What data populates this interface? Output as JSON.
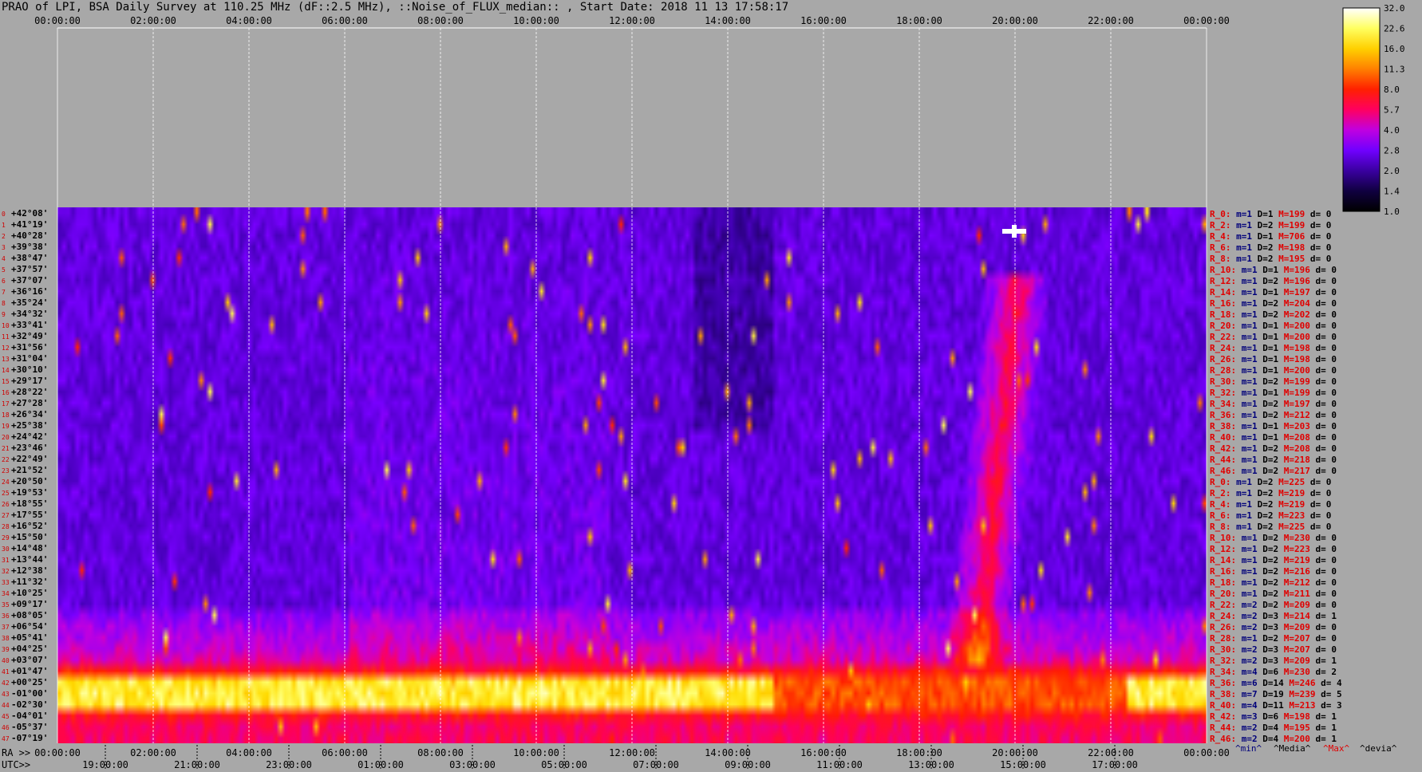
{
  "title": "PRAO of LPI, BSA Daily Survey at 110.25 MHz (dF::2.5 MHz), ::Noise_of_FLUX_median:: , Start Date: 2018 11 13 17:58:17",
  "axis_prefix": {
    "ra": "RA >>",
    "utc": "UTC>>"
  },
  "chart_data": {
    "type": "heatmap",
    "title": "PRAO of LPI, BSA Daily Survey at 110.25 MHz (dF::2.5 MHz), ::Noise_of_FLUX_median:: , Start Date: 2018 11 13 17:58:17",
    "x_ra_ticks": [
      "00:00:00",
      "02:00:00",
      "04:00:00",
      "06:00:00",
      "08:00:00",
      "10:00:00",
      "12:00:00",
      "14:00:00",
      "16:00:00",
      "18:00:00",
      "20:00:00",
      "22:00:00",
      "00:00:00"
    ],
    "x_utc_ticks": [
      "19:00:00",
      "21:00:00",
      "23:00:00",
      "01:00:00",
      "03:00:00",
      "05:00:00",
      "07:00:00",
      "09:00:00",
      "11:00:00",
      "13:00:00",
      "15:00:00",
      "17:00:00"
    ],
    "y_declination_labels": [
      "+42°08'",
      "+41°19'",
      "+40°28'",
      "+39°38'",
      "+38°47'",
      "+37°57'",
      "+37°07'",
      "+36°16'",
      "+35°24'",
      "+34°32'",
      "+33°41'",
      "+32°49'",
      "+31°56'",
      "+31°04'",
      "+30°10'",
      "+29°17'",
      "+28°22'",
      "+27°28'",
      "+26°34'",
      "+25°38'",
      "+24°42'",
      "+23°46'",
      "+22°49'",
      "+21°52'",
      "+20°50'",
      "+19°53'",
      "+18°55'",
      "+17°55'",
      "+16°52'",
      "+15°50'",
      "+14°48'",
      "+13°44'",
      "+12°38'",
      "+11°32'",
      "+10°25'",
      "+09°17'",
      "+08°05'",
      "+06°54'",
      "+05°41'",
      "+04°25'",
      "+03°07'",
      "+01°47'",
      "+00°25'",
      "-01°00'",
      "-02°30'",
      "-04°01'",
      "-05°37'",
      "-07°19'"
    ],
    "colorbar_ticks": [
      32.0,
      22.6,
      16.0,
      11.3,
      8.0,
      5.7,
      4.0,
      2.8,
      2.0,
      1.4,
      1.0
    ],
    "colorbar_scale": "log",
    "color_range": [
      1.0,
      32.0
    ],
    "row_stats": [
      {
        "r": "R_0:",
        "m": "m=1",
        "d": "D=1",
        "M": "M=199",
        "dev": "d= 0"
      },
      {
        "r": "R_2:",
        "m": "m=1",
        "d": "D=2",
        "M": "M=199",
        "dev": "d= 0"
      },
      {
        "r": "R_4:",
        "m": "m=1",
        "d": "D=1",
        "M": "M=706",
        "dev": "d= 0"
      },
      {
        "r": "R_6:",
        "m": "m=1",
        "d": "D=2",
        "M": "M=198",
        "dev": "d= 0"
      },
      {
        "r": "R_8:",
        "m": "m=1",
        "d": "D=2",
        "M": "M=195",
        "dev": "d= 0"
      },
      {
        "r": "R_10:",
        "m": "m=1",
        "d": "D=1",
        "M": "M=196",
        "dev": "d= 0"
      },
      {
        "r": "R_12:",
        "m": "m=1",
        "d": "D=2",
        "M": "M=196",
        "dev": "d= 0"
      },
      {
        "r": "R_14:",
        "m": "m=1",
        "d": "D=1",
        "M": "M=197",
        "dev": "d= 0"
      },
      {
        "r": "R_16:",
        "m": "m=1",
        "d": "D=2",
        "M": "M=204",
        "dev": "d= 0"
      },
      {
        "r": "R_18:",
        "m": "m=1",
        "d": "D=2",
        "M": "M=202",
        "dev": "d= 0"
      },
      {
        "r": "R_20:",
        "m": "m=1",
        "d": "D=1",
        "M": "M=200",
        "dev": "d= 0"
      },
      {
        "r": "R_22:",
        "m": "m=1",
        "d": "D=1",
        "M": "M=200",
        "dev": "d= 0"
      },
      {
        "r": "R_24:",
        "m": "m=1",
        "d": "D=1",
        "M": "M=198",
        "dev": "d= 0"
      },
      {
        "r": "R_26:",
        "m": "m=1",
        "d": "D=1",
        "M": "M=198",
        "dev": "d= 0"
      },
      {
        "r": "R_28:",
        "m": "m=1",
        "d": "D=1",
        "M": "M=200",
        "dev": "d= 0"
      },
      {
        "r": "R_30:",
        "m": "m=1",
        "d": "D=2",
        "M": "M=199",
        "dev": "d= 0"
      },
      {
        "r": "R_32:",
        "m": "m=1",
        "d": "D=1",
        "M": "M=199",
        "dev": "d= 0"
      },
      {
        "r": "R_34:",
        "m": "m=1",
        "d": "D=2",
        "M": "M=197",
        "dev": "d= 0"
      },
      {
        "r": "R_36:",
        "m": "m=1",
        "d": "D=2",
        "M": "M=212",
        "dev": "d= 0"
      },
      {
        "r": "R_38:",
        "m": "m=1",
        "d": "D=1",
        "M": "M=203",
        "dev": "d= 0"
      },
      {
        "r": "R_40:",
        "m": "m=1",
        "d": "D=1",
        "M": "M=208",
        "dev": "d= 0"
      },
      {
        "r": "R_42:",
        "m": "m=1",
        "d": "D=2",
        "M": "M=208",
        "dev": "d= 0"
      },
      {
        "r": "R_44:",
        "m": "m=1",
        "d": "D=2",
        "M": "M=218",
        "dev": "d= 0"
      },
      {
        "r": "R_46:",
        "m": "m=1",
        "d": "D=2",
        "M": "M=217",
        "dev": "d= 0"
      },
      {
        "r": "R_0:",
        "m": "m=1",
        "d": "D=2",
        "M": "M=225",
        "dev": "d= 0"
      },
      {
        "r": "R_2:",
        "m": "m=1",
        "d": "D=2",
        "M": "M=219",
        "dev": "d= 0"
      },
      {
        "r": "R_4:",
        "m": "m=1",
        "d": "D=2",
        "M": "M=219",
        "dev": "d= 0"
      },
      {
        "r": "R_6:",
        "m": "m=1",
        "d": "D=2",
        "M": "M=223",
        "dev": "d= 0"
      },
      {
        "r": "R_8:",
        "m": "m=1",
        "d": "D=2",
        "M": "M=225",
        "dev": "d= 0"
      },
      {
        "r": "R_10:",
        "m": "m=1",
        "d": "D=2",
        "M": "M=230",
        "dev": "d= 0"
      },
      {
        "r": "R_12:",
        "m": "m=1",
        "d": "D=2",
        "M": "M=223",
        "dev": "d= 0"
      },
      {
        "r": "R_14:",
        "m": "m=1",
        "d": "D=2",
        "M": "M=219",
        "dev": "d= 0"
      },
      {
        "r": "R_16:",
        "m": "m=1",
        "d": "D=2",
        "M": "M=216",
        "dev": "d= 0"
      },
      {
        "r": "R_18:",
        "m": "m=1",
        "d": "D=2",
        "M": "M=212",
        "dev": "d= 0"
      },
      {
        "r": "R_20:",
        "m": "m=1",
        "d": "D=2",
        "M": "M=211",
        "dev": "d= 0"
      },
      {
        "r": "R_22:",
        "m": "m=2",
        "d": "D=2",
        "M": "M=209",
        "dev": "d= 0"
      },
      {
        "r": "R_24:",
        "m": "m=2",
        "d": "D=3",
        "M": "M=214",
        "dev": "d= 1"
      },
      {
        "r": "R_26:",
        "m": "m=2",
        "d": "D=3",
        "M": "M=209",
        "dev": "d= 0"
      },
      {
        "r": "R_28:",
        "m": "m=1",
        "d": "D=2",
        "M": "M=207",
        "dev": "d= 0"
      },
      {
        "r": "R_30:",
        "m": "m=2",
        "d": "D=3",
        "M": "M=207",
        "dev": "d= 0"
      },
      {
        "r": "R_32:",
        "m": "m=2",
        "d": "D=3",
        "M": "M=209",
        "dev": "d= 1"
      },
      {
        "r": "R_34:",
        "m": "m=4",
        "d": "D=6",
        "M": "M=230",
        "dev": "d= 2"
      },
      {
        "r": "R_36:",
        "m": "m=6",
        "d": "D=14",
        "M": "M=246",
        "dev": "d= 4"
      },
      {
        "r": "R_38:",
        "m": "m=7",
        "d": "D=19",
        "M": "M=239",
        "dev": "d= 5"
      },
      {
        "r": "R_40:",
        "m": "m=4",
        "d": "D=11",
        "M": "M=213",
        "dev": "d= 3"
      },
      {
        "r": "R_42:",
        "m": "m=3",
        "d": "D=6",
        "M": "M=198",
        "dev": "d= 1"
      },
      {
        "r": "R_44:",
        "m": "m=2",
        "d": "D=4",
        "M": "M=195",
        "dev": "d= 1"
      },
      {
        "r": "R_46:",
        "m": "m=2",
        "d": "D=4",
        "M": "M=200",
        "dev": "d= 1"
      }
    ],
    "stat_legend": [
      "^min^",
      "^Media^",
      "^Max^",
      "^devia^"
    ]
  },
  "colors": {
    "background": "#a8a8a8",
    "stat_m": "#00007a",
    "stat_M": "#e00000",
    "stat_R": "#e00000"
  }
}
